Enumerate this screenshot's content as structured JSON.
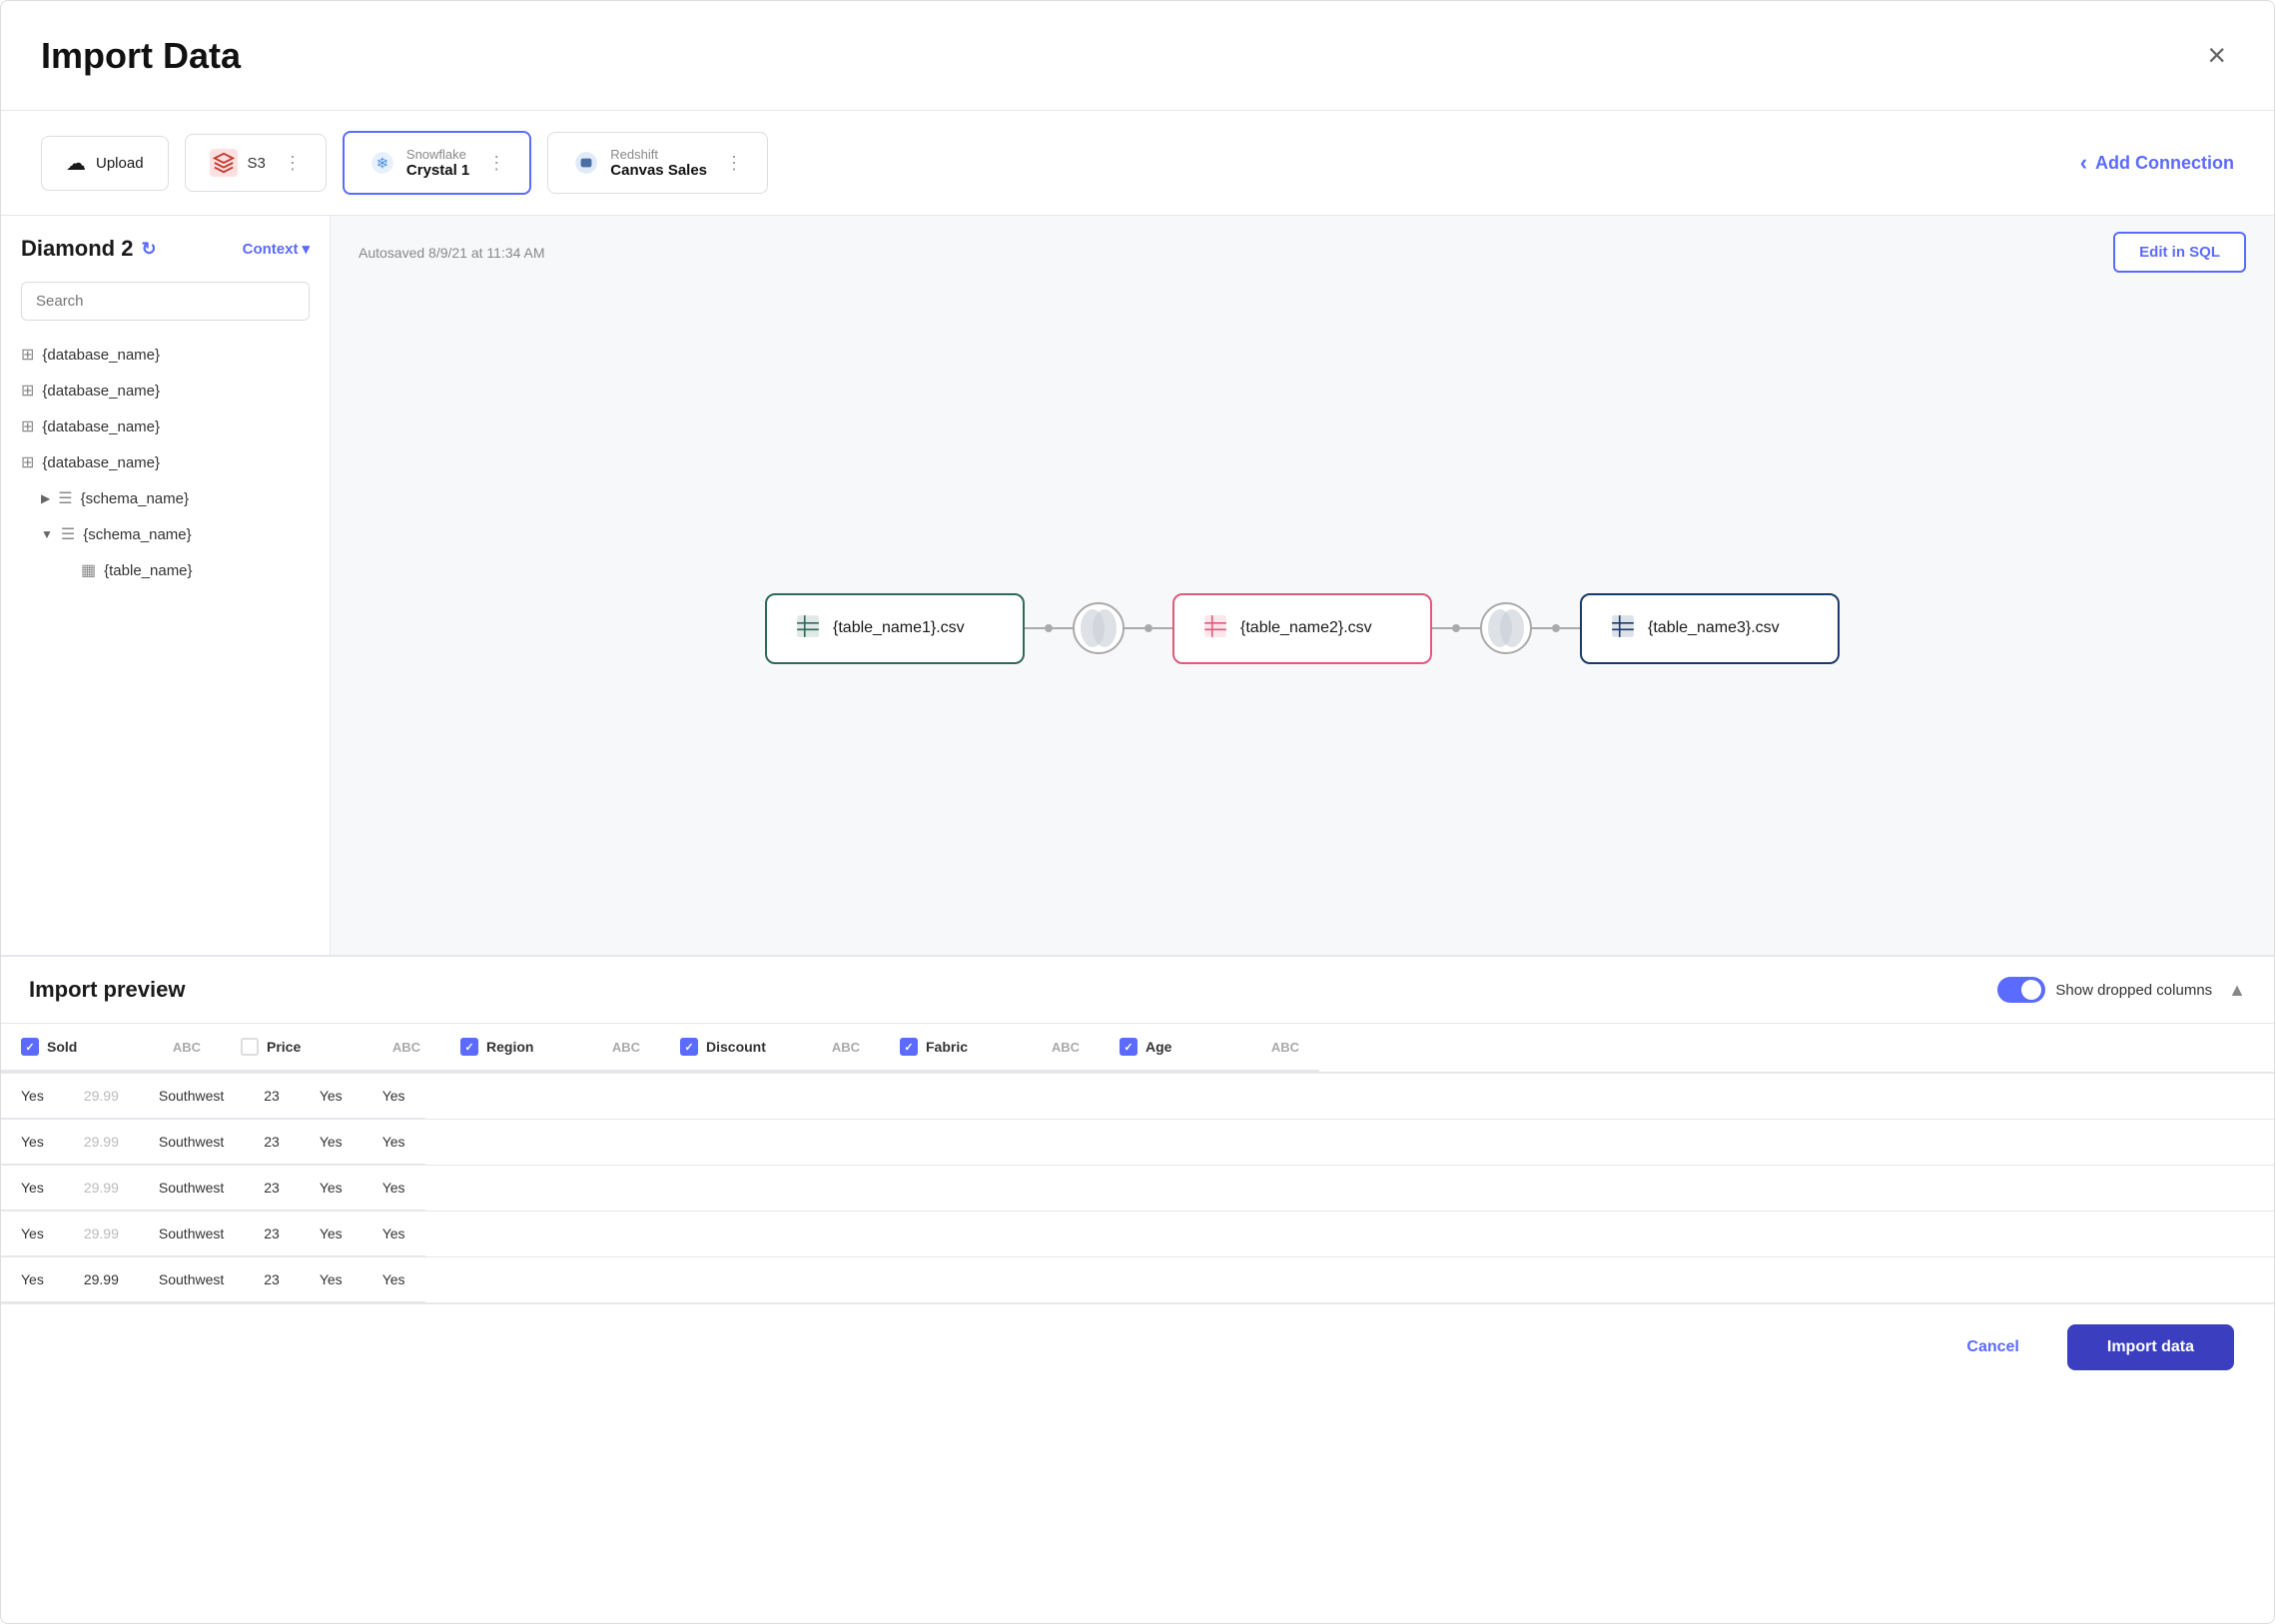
{
  "modal": {
    "title": "Import Data",
    "close_label": "×"
  },
  "connections": {
    "upload_label": "Upload",
    "s3_label": "S3",
    "snowflake_name": "Snowflake",
    "snowflake_sub": "Crystal 1",
    "redshift_name": "Redshift",
    "redshift_sub": "Canvas Sales",
    "add_connection_label": "Add Connection"
  },
  "sidebar": {
    "title": "Diamond 2",
    "context_label": "Context",
    "search_placeholder": "Search",
    "databases": [
      {
        "label": "{database_name}"
      },
      {
        "label": "{database_name}"
      },
      {
        "label": "{database_name}"
      },
      {
        "label": "{database_name}"
      }
    ],
    "schema_collapsed": {
      "label": "{schema_name}"
    },
    "schema_expanded": {
      "label": "{schema_name}"
    },
    "table": {
      "label": "{table_name}"
    }
  },
  "canvas": {
    "autosave": "Autosaved 8/9/21 at 11:34 AM",
    "edit_sql_label": "Edit in SQL",
    "nodes": [
      {
        "label": "{table_name1}.csv",
        "color": "green"
      },
      {
        "label": "{table_name2}.csv",
        "color": "pink"
      },
      {
        "label": "{table_name3}.csv",
        "color": "dark-blue"
      }
    ]
  },
  "import_preview": {
    "title": "Import preview",
    "show_dropped_label": "Show dropped columns",
    "collapse_label": "▲",
    "columns": [
      {
        "name": "Sold",
        "type": "ABC",
        "checked": true
      },
      {
        "name": "Price",
        "type": "ABC",
        "checked": false
      },
      {
        "name": "Region",
        "type": "ABC",
        "checked": true
      },
      {
        "name": "Discount",
        "type": "ABC",
        "checked": true
      },
      {
        "name": "Fabric",
        "type": "ABC",
        "checked": true
      },
      {
        "name": "Age",
        "type": "ABC",
        "checked": true
      }
    ],
    "rows": [
      {
        "sold": "Yes",
        "price": "29.99",
        "region": "Southwest",
        "discount": "23",
        "fabric": "Yes",
        "age": "Yes",
        "price_dimmed": true
      },
      {
        "sold": "Yes",
        "price": "29.99",
        "region": "Southwest",
        "discount": "23",
        "fabric": "Yes",
        "age": "Yes",
        "price_dimmed": true
      },
      {
        "sold": "Yes",
        "price": "29.99",
        "region": "Southwest",
        "discount": "23",
        "fabric": "Yes",
        "age": "Yes",
        "price_dimmed": true
      },
      {
        "sold": "Yes",
        "price": "29.99",
        "region": "Southwest",
        "discount": "23",
        "fabric": "Yes",
        "age": "Yes",
        "price_dimmed": true
      },
      {
        "sold": "Yes",
        "price": "29.99",
        "region": "Southwest",
        "discount": "23",
        "fabric": "Yes",
        "age": "Yes",
        "price_dimmed": false
      }
    ]
  },
  "footer": {
    "cancel_label": "Cancel",
    "import_label": "Import data"
  }
}
